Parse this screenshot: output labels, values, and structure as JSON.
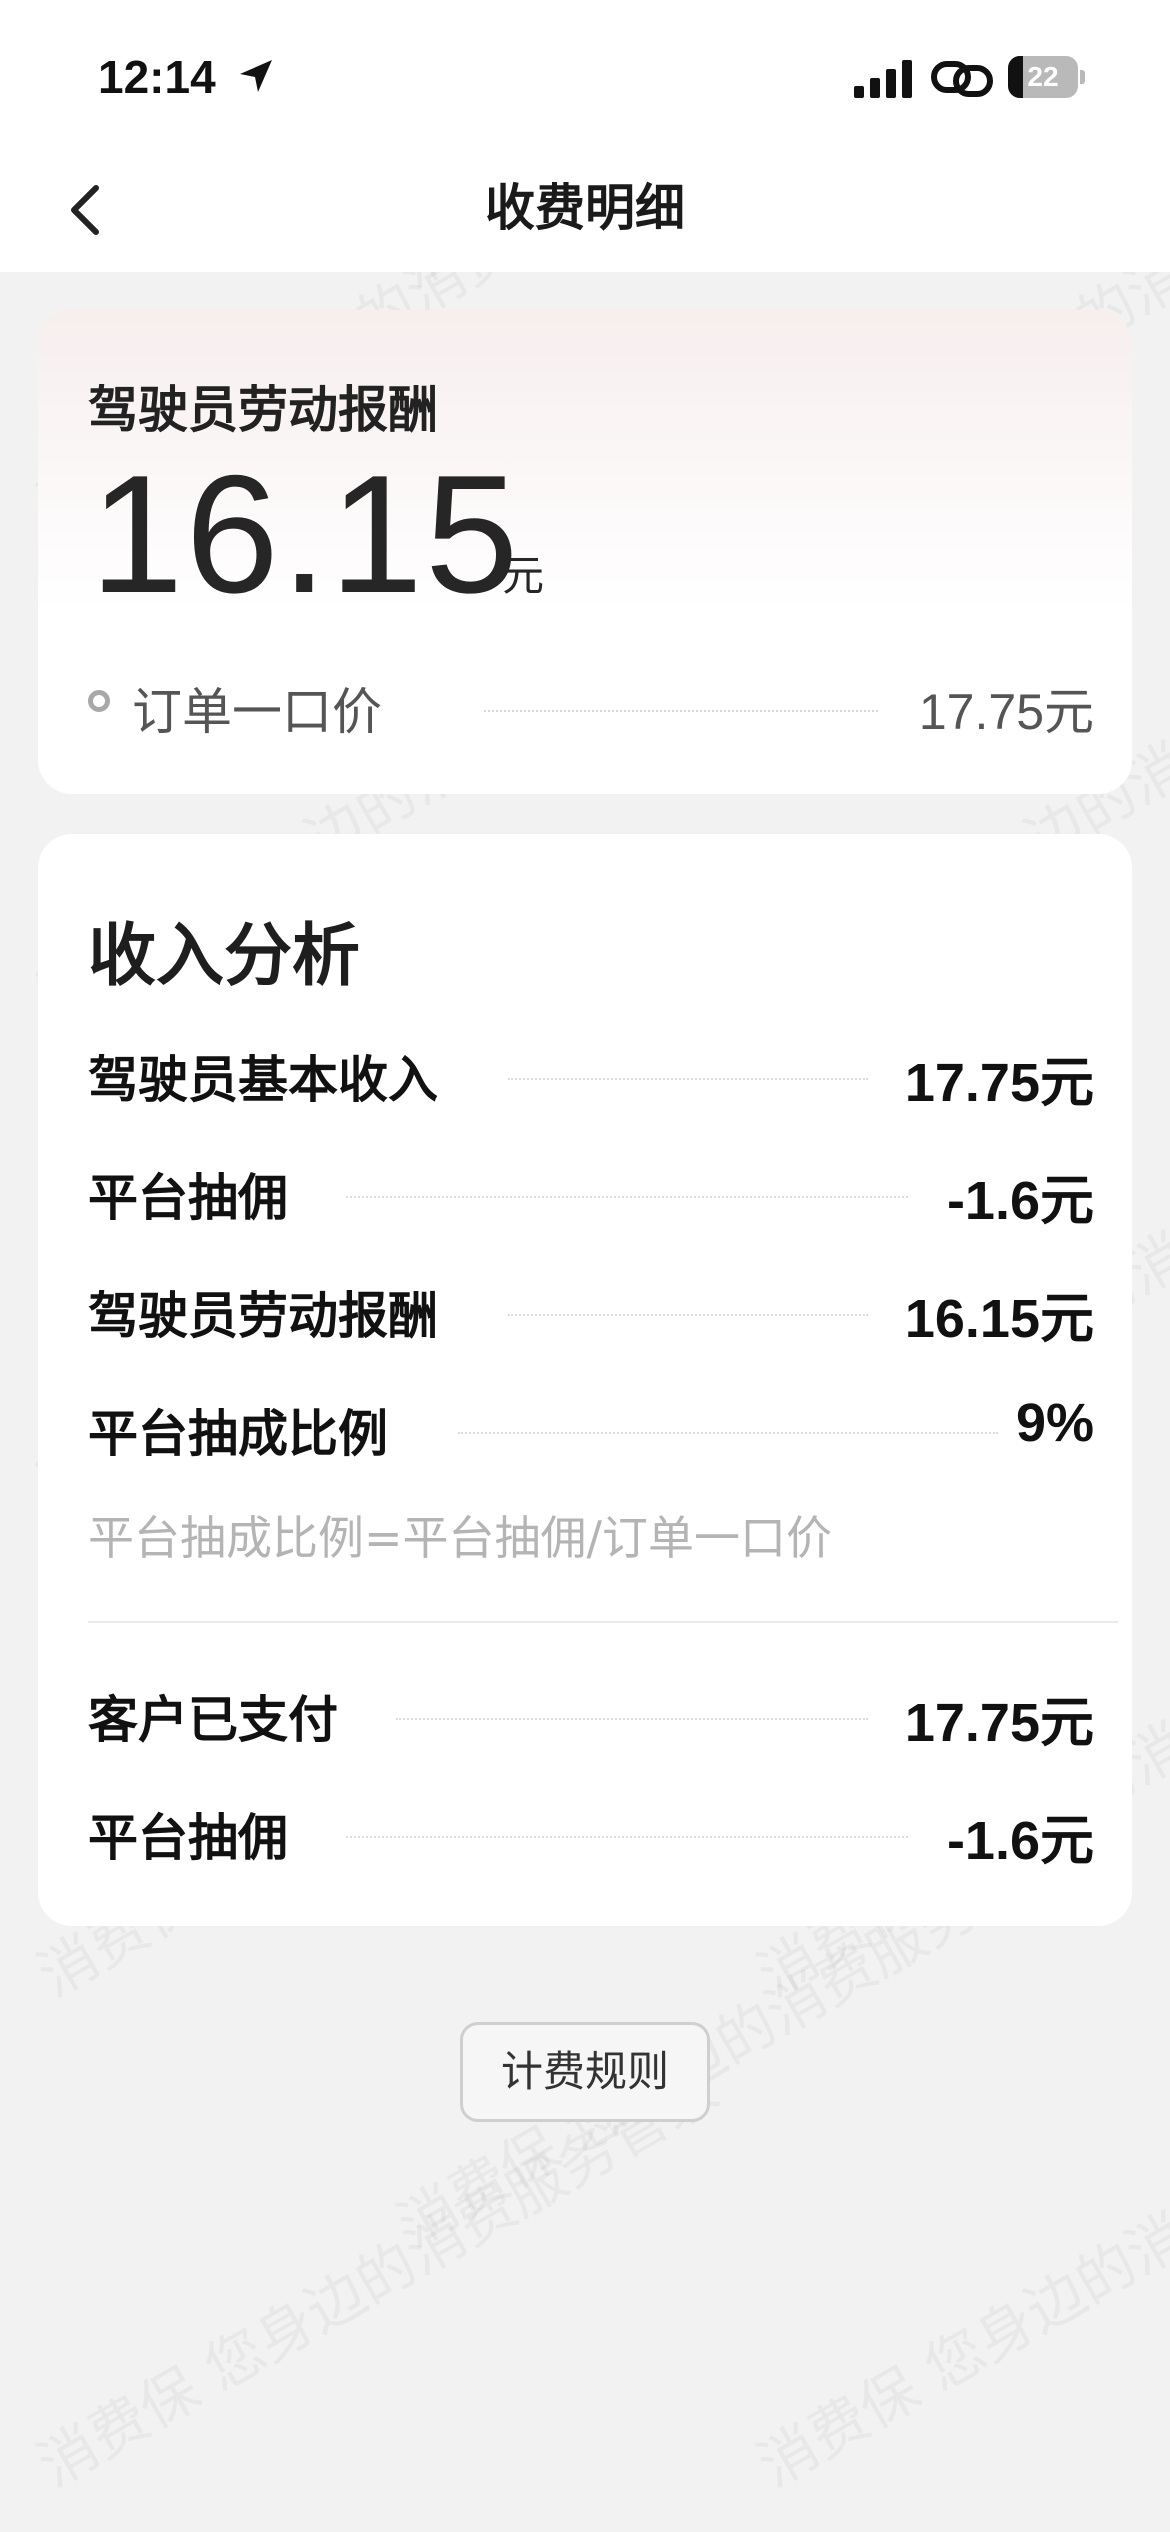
{
  "status_bar": {
    "time": "12:14",
    "battery_level": "22",
    "battery_fraction": 0.22,
    "icons": [
      "location-arrow-icon",
      "cellular-signal-icon",
      "link-icon",
      "battery-icon"
    ]
  },
  "nav": {
    "title": "收费明细",
    "back_icon": "chevron-left-icon"
  },
  "summary": {
    "label": "驾驶员劳动报酬",
    "amount": "16.15",
    "unit": "元",
    "order_price_label": "订单一口价",
    "order_price_value": "17.75元"
  },
  "analysis": {
    "title": "收入分析",
    "rows": [
      {
        "label": "驾驶员基本收入",
        "value": "17.75元"
      },
      {
        "label": "平台抽佣",
        "value": "-1.6元"
      },
      {
        "label": "驾驶员劳动报酬",
        "value": "16.15元"
      },
      {
        "label": "平台抽成比例",
        "value": "9%"
      }
    ],
    "formula_note": "平台抽成比例=平台抽佣/订单一口价",
    "payment_rows": [
      {
        "label": "客户已支付",
        "value": "17.75元"
      },
      {
        "label": "平台抽佣",
        "value": "-1.6元"
      }
    ]
  },
  "rules_button": {
    "label": "计费规则"
  },
  "watermark": {
    "text": "消费保 您身边的消费服务管家"
  },
  "colors": {
    "background": "#f2f2f2",
    "card": "#ffffff",
    "card_gradient_top": "#f7eeee",
    "text_primary": "#111111",
    "text_muted": "#b4b4b4"
  }
}
